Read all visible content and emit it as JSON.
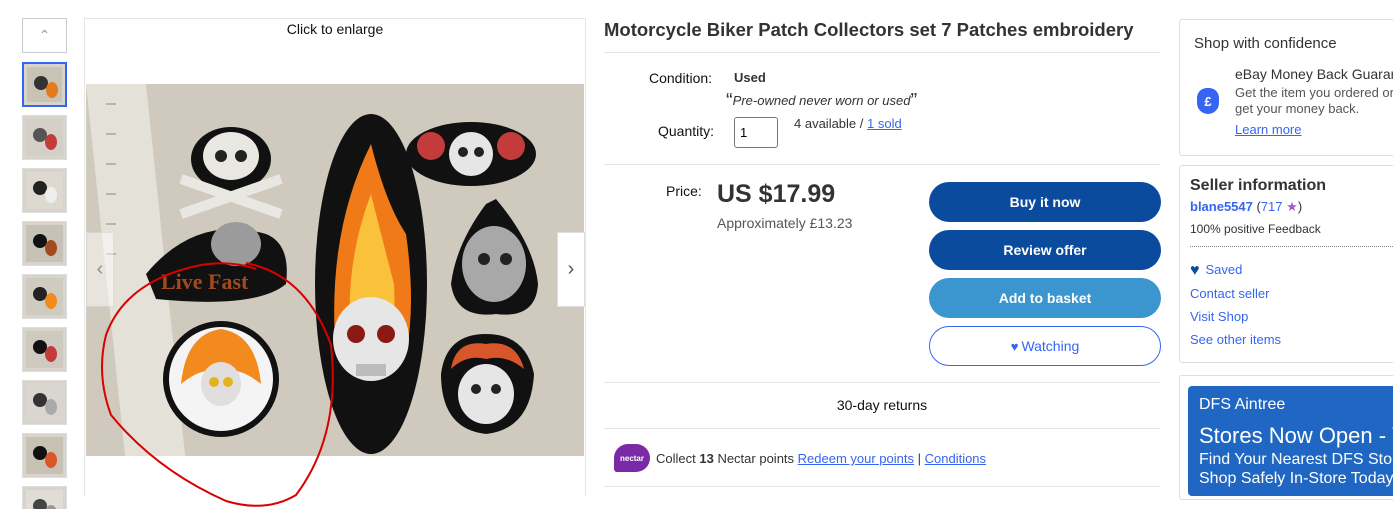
{
  "gallery": {
    "enlarge_label": "Click to enlarge",
    "thumbnail_count": 9,
    "selected_thumbnail": 1
  },
  "item": {
    "title": "Motorcycle Biker Patch Collectors set 7 Patches embroidery",
    "condition_label": "Condition:",
    "condition_value": "Used",
    "condition_open_quote": "“",
    "condition_description": "Pre-owned never worn or used",
    "condition_close_quote": "”",
    "quantity_label": "Quantity:",
    "quantity_value": "1",
    "available_text": "4 available / ",
    "sold_link": "1 sold",
    "price_label": "Price:",
    "price": "US $17.99",
    "approx_price": "Approximately £13.23"
  },
  "actions": {
    "buy_now": "Buy it now",
    "review_offer": "Review offer",
    "add_to_basket": "Add to basket",
    "watching": "Watching"
  },
  "returns": "30-day returns",
  "nectar": {
    "logo_text": "nectar",
    "collect_prefix": "Collect ",
    "points": "13",
    "collect_suffix": " Nectar points ",
    "redeem_link": "Redeem your points",
    "divider": " | ",
    "conditions_link": "Conditions"
  },
  "confidence": {
    "title": "Shop with confidence",
    "guarantee_title": "eBay Money Back Guarantee",
    "guarantee_desc": "Get the item you ordered or get your money back.",
    "learn_more": "Learn more",
    "icon": "pound-shield-icon"
  },
  "seller": {
    "title": "Seller information",
    "name": "blane5547",
    "score_open": " (",
    "score": "717",
    "score_close": ")",
    "feedback": "100% positive Feedback",
    "saved": "Saved",
    "contact": "Contact seller",
    "visit_shop": "Visit Shop",
    "other_items": "See other items"
  },
  "ad": {
    "store": "DFS Aintree",
    "headline": "Stores Now Open - Visit Us",
    "line1": "Find Your Nearest DFS Store",
    "line2": "Shop Safely In-Store Today"
  },
  "colors": {
    "ebay_blue": "#3665f3",
    "button_dark_blue": "#0b4b9e",
    "button_light_blue": "#3b95cf",
    "nectar_purple": "#7a2aa6",
    "ad_blue": "#1f67c2"
  }
}
